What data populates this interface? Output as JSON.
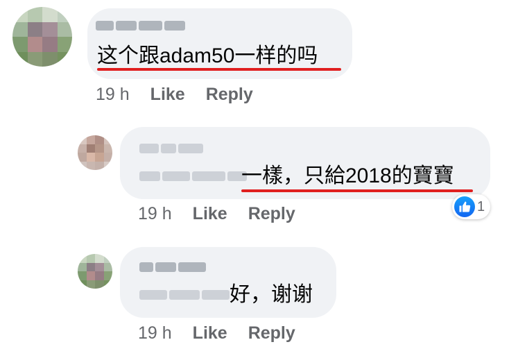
{
  "colors": {
    "bubble": "#f0f2f5",
    "underline": "#e02020",
    "meta": "#65676b",
    "like_blue": "#1877f2"
  },
  "comments": [
    {
      "name_redacted": true,
      "text": "这个跟adam50一样的吗",
      "time": "19 h",
      "like_label": "Like",
      "reply_label": "Reply"
    },
    {
      "name_redacted": true,
      "mention_redacted": true,
      "text": "一樣，只給2018的寶寶",
      "time": "19 h",
      "like_label": "Like",
      "reply_label": "Reply",
      "reaction_icon": "thumbs-up-icon",
      "reaction_count": "1"
    },
    {
      "name_redacted": true,
      "mention_redacted": true,
      "text": "好，谢谢",
      "time": "19 h",
      "like_label": "Like",
      "reply_label": "Reply"
    }
  ]
}
